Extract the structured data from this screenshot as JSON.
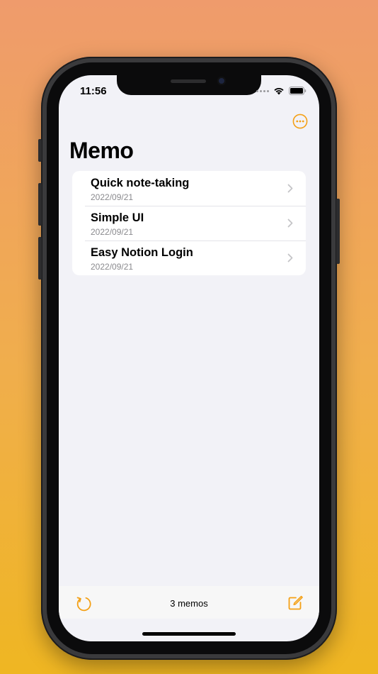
{
  "status_bar": {
    "time": "11:56"
  },
  "header": {
    "title": "Memo",
    "more_icon": "ellipsis-circle-icon"
  },
  "memos": [
    {
      "title": "Quick note-taking",
      "date": "2022/09/21"
    },
    {
      "title": "Simple UI",
      "date": "2022/09/21"
    },
    {
      "title": "Easy Notion Login",
      "date": "2022/09/21"
    }
  ],
  "toolbar": {
    "count_label": "3 memos",
    "refresh_icon": "refresh-icon",
    "compose_icon": "compose-icon"
  },
  "colors": {
    "accent": "#F4A015",
    "background_top": "#EF9B6C",
    "background_bottom": "#EFB622",
    "screen_background": "#F2F2F7",
    "secondary_text": "#8A8A8E"
  }
}
